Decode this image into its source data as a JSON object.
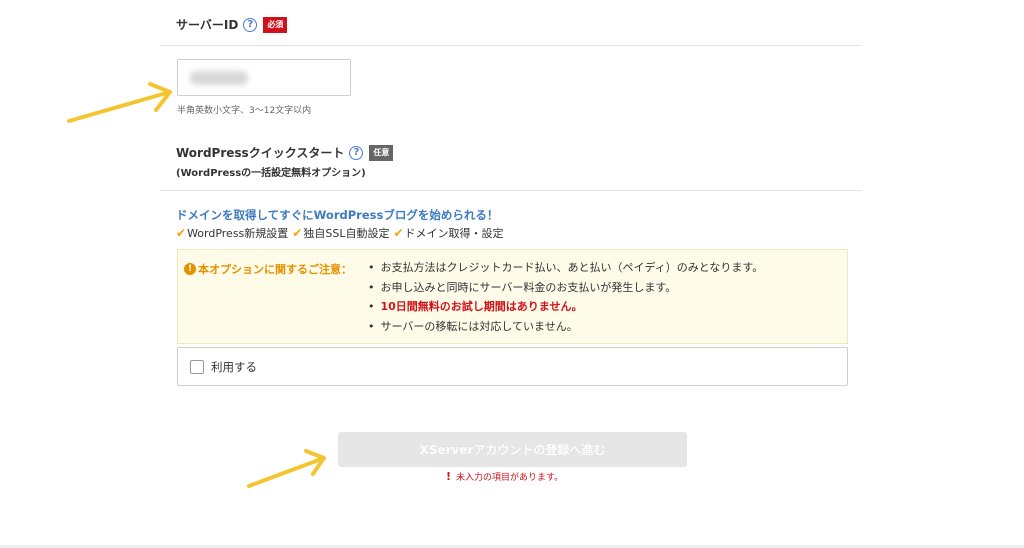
{
  "server_id": {
    "label": "サーバーID",
    "help": "?",
    "badge": "必須",
    "hint": "半角英数小文字、3～12文字以内"
  },
  "wp_quickstart": {
    "label": "WordPressクイックスタート",
    "help": "?",
    "badge": "任意",
    "sub": "(WordPressの一括設定無料オプション)"
  },
  "promo": {
    "title": "ドメインを取得してすぐにWordPressブログを始められる！",
    "features": [
      "WordPress新規設置",
      "独自SSL自動設定",
      "ドメイン取得・設定"
    ]
  },
  "notice": {
    "icon": "!",
    "heading": "本オプションに関するご注意：",
    "items": [
      "お支払方法はクレジットカード払い、あと払い（ペイディ）のみとなります。",
      "お申し込みと同時にサーバー料金のお支払いが発生します。",
      "10日間無料のお試し期間はありません。",
      "サーバーの移転には対応していません。"
    ]
  },
  "use_option": {
    "label": "利用する"
  },
  "submit": {
    "label": "XServerアカウントの登録へ進む",
    "error_icon": "!",
    "error": "未入力の項目があります。"
  },
  "colors": {
    "required": "#d0111b",
    "promo": "#3d7bbf",
    "check": "#f0a20c",
    "arrow": "#f5c531"
  },
  "icons": {
    "help": "question-circle-icon",
    "check": "checkmark-icon",
    "warning": "exclamation-circle-icon",
    "arrow": "arrow-annotation-icon"
  }
}
